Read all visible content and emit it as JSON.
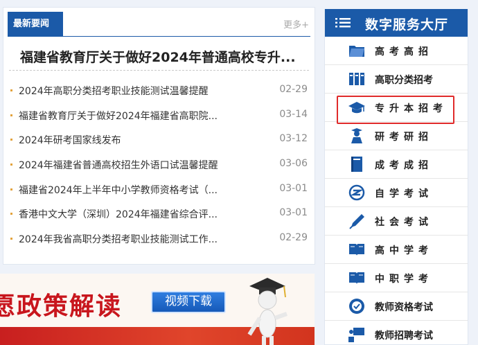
{
  "news": {
    "tab_label": "最新要闻",
    "more_label": "更多+",
    "headline": "福建省教育厅关于做好2024年普通高校专升...",
    "items": [
      {
        "title": "2024年高职分类招考职业技能测试温馨提醒",
        "date": "02-29"
      },
      {
        "title": "福建省教育厅关于做好2024年福建省高职院...",
        "date": "03-14"
      },
      {
        "title": "2024年研考国家线发布",
        "date": "03-12"
      },
      {
        "title": "2024年福建省普通高校招生外语口试温馨提醒",
        "date": "03-06"
      },
      {
        "title": "福建省2024年上半年中小学教师资格考试（...",
        "date": "03-01"
      },
      {
        "title": "香港中文大学（深圳）2024年福建省综合评...",
        "date": "03-01"
      },
      {
        "title": "2024年我省高职分类招考职业技能测试工作...",
        "date": "02-29"
      }
    ]
  },
  "banner": {
    "title": "愿政策解读",
    "video_button": "视频下载"
  },
  "services": {
    "title": "数字服务大厅",
    "items": [
      {
        "label": "高考高招",
        "icon": "folder-icon"
      },
      {
        "label": "高职分类招考",
        "icon": "books-icon"
      },
      {
        "label": "专升本招考",
        "icon": "graduation-cap-icon"
      },
      {
        "label": "研考研招",
        "icon": "graduate-figure-icon"
      },
      {
        "label": "成考成招",
        "icon": "notebook-icon"
      },
      {
        "label": "自学考试",
        "icon": "self-study-icon"
      },
      {
        "label": "社会考试",
        "icon": "pen-icon"
      },
      {
        "label": "高中学考",
        "icon": "open-book-icon"
      },
      {
        "label": "中职学考",
        "icon": "open-book-icon"
      },
      {
        "label": "教师资格考试",
        "icon": "badge-icon"
      },
      {
        "label": "教师招聘考试",
        "icon": "teacher-board-icon"
      }
    ]
  },
  "colors": {
    "brand_blue": "#1b5aa8",
    "highlight_red": "#e02a2a",
    "bullet": "#e3a23b"
  }
}
